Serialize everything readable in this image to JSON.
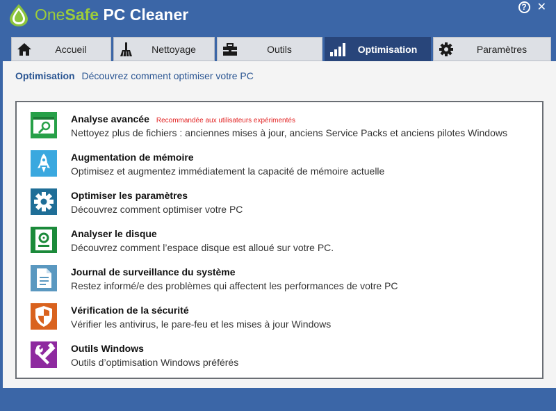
{
  "app": {
    "title_part1": "One",
    "title_part2": "Safe",
    "title_part3": " PC Cleaner"
  },
  "window_controls": {
    "help": "?",
    "close": "✕"
  },
  "tabs": [
    {
      "label": "Accueil",
      "icon": "home-icon",
      "active": false
    },
    {
      "label": "Nettoyage",
      "icon": "broom-icon",
      "active": false
    },
    {
      "label": "Outils",
      "icon": "toolbox-icon",
      "active": false
    },
    {
      "label": "Optimisation",
      "icon": "signal-bars-icon",
      "active": true
    },
    {
      "label": "Paramètres",
      "icon": "gear-icon",
      "active": false
    }
  ],
  "breadcrumb": {
    "main": "Optimisation",
    "sub": "Découvrez comment optimiser votre PC"
  },
  "items": [
    {
      "title": "Analyse avancée",
      "badge": "Recommandée aux utilisateurs expérimentés",
      "desc": "Nettoyez plus de fichiers : anciennes mises à jour, anciens Service Packs et anciens pilotes Windows",
      "icon": "advanced-scan-icon",
      "color": "#27a048"
    },
    {
      "title": "Augmentation de mémoire",
      "badge": "",
      "desc": "Optimisez et augmentez immédiatement la capacité de mémoire actuelle",
      "icon": "rocket-icon",
      "color": "#3aa8df"
    },
    {
      "title": "Optimiser les paramètres",
      "badge": "",
      "desc": "Découvrez comment optimiser votre PC",
      "icon": "gear-icon",
      "color": "#1f6e97"
    },
    {
      "title": "Analyser le disque",
      "badge": "",
      "desc": "Découvrez comment l’espace disque est alloué sur votre PC.",
      "icon": "disk-icon",
      "color": "#1b8a3a"
    },
    {
      "title": "Journal de surveillance du système",
      "badge": "",
      "desc": "Restez informé/e des problèmes qui affectent les performances de votre PC",
      "icon": "document-icon",
      "color": "#5a98c0"
    },
    {
      "title": "Vérification de la sécurité",
      "badge": "",
      "desc": "Vérifier les antivirus, le pare-feu et les mises à jour Windows",
      "icon": "shield-icon",
      "color": "#d9621e"
    },
    {
      "title": "Outils Windows",
      "badge": "",
      "desc": "Outils d’optimisation Windows préférés",
      "icon": "tools-icon",
      "color": "#8e2a9f"
    }
  ]
}
